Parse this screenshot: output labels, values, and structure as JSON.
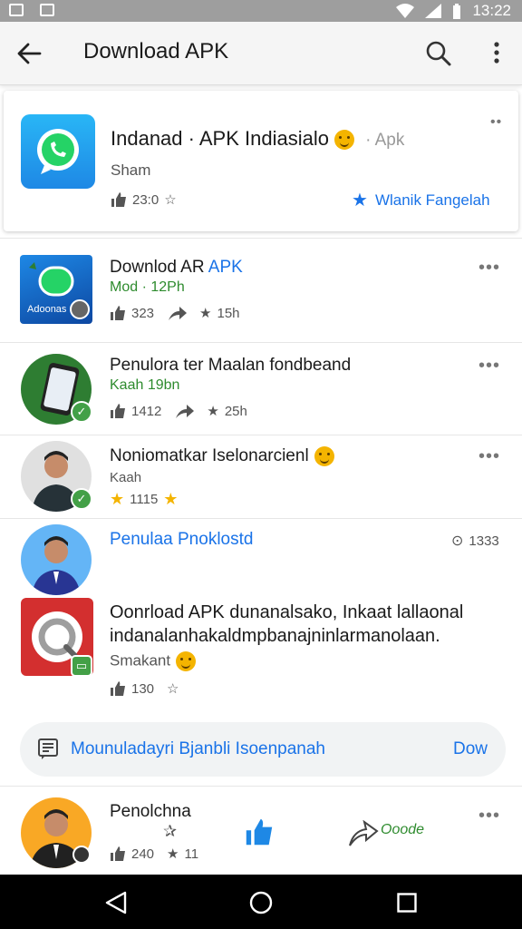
{
  "status_bar": {
    "time": "13:22"
  },
  "app_bar": {
    "title": "Download APK"
  },
  "featured": {
    "title": "Indanad · APK Indiasialo",
    "tag": "· Apk",
    "subtitle": "Sham",
    "likes": "23:0",
    "action_label": "Wlanik Fangelah"
  },
  "items": [
    {
      "title_part1": "Downlod AR ",
      "title_part2": "APK",
      "subtitle": "Mod · 12Ph",
      "likes": "323",
      "stars": "15h",
      "icon_label": "Adoonas"
    },
    {
      "title": "Penulora ter Maalan fondbeand",
      "subtitle": "Kaah 19bn",
      "likes": "1412",
      "stars": "25h"
    },
    {
      "title": "Noniomatkar Iselonarcienl",
      "subtitle": "Kaah",
      "rating": "1115"
    },
    {
      "title": "Penulaa Pnoklostd",
      "views": "1333"
    },
    {
      "title_line1": "Oonrload APK dunanalsako, Inkaat lallaonal",
      "title_line2": "indanalanhakaldmpbanajninlarmanolaan.",
      "subtitle": "Smakant",
      "likes": "130"
    },
    {
      "title": "Penolchna",
      "likes": "240",
      "stars": "11",
      "sign": "Ooode"
    }
  ],
  "promo": {
    "text": "Mounuladayri Bjanbli Isoenpanah",
    "action": "Dow"
  },
  "colors": {
    "accent_blue": "#1a73e8",
    "green": "#2e8b2e",
    "whatsapp_green": "#25d366",
    "nav_bg": "#000000"
  }
}
